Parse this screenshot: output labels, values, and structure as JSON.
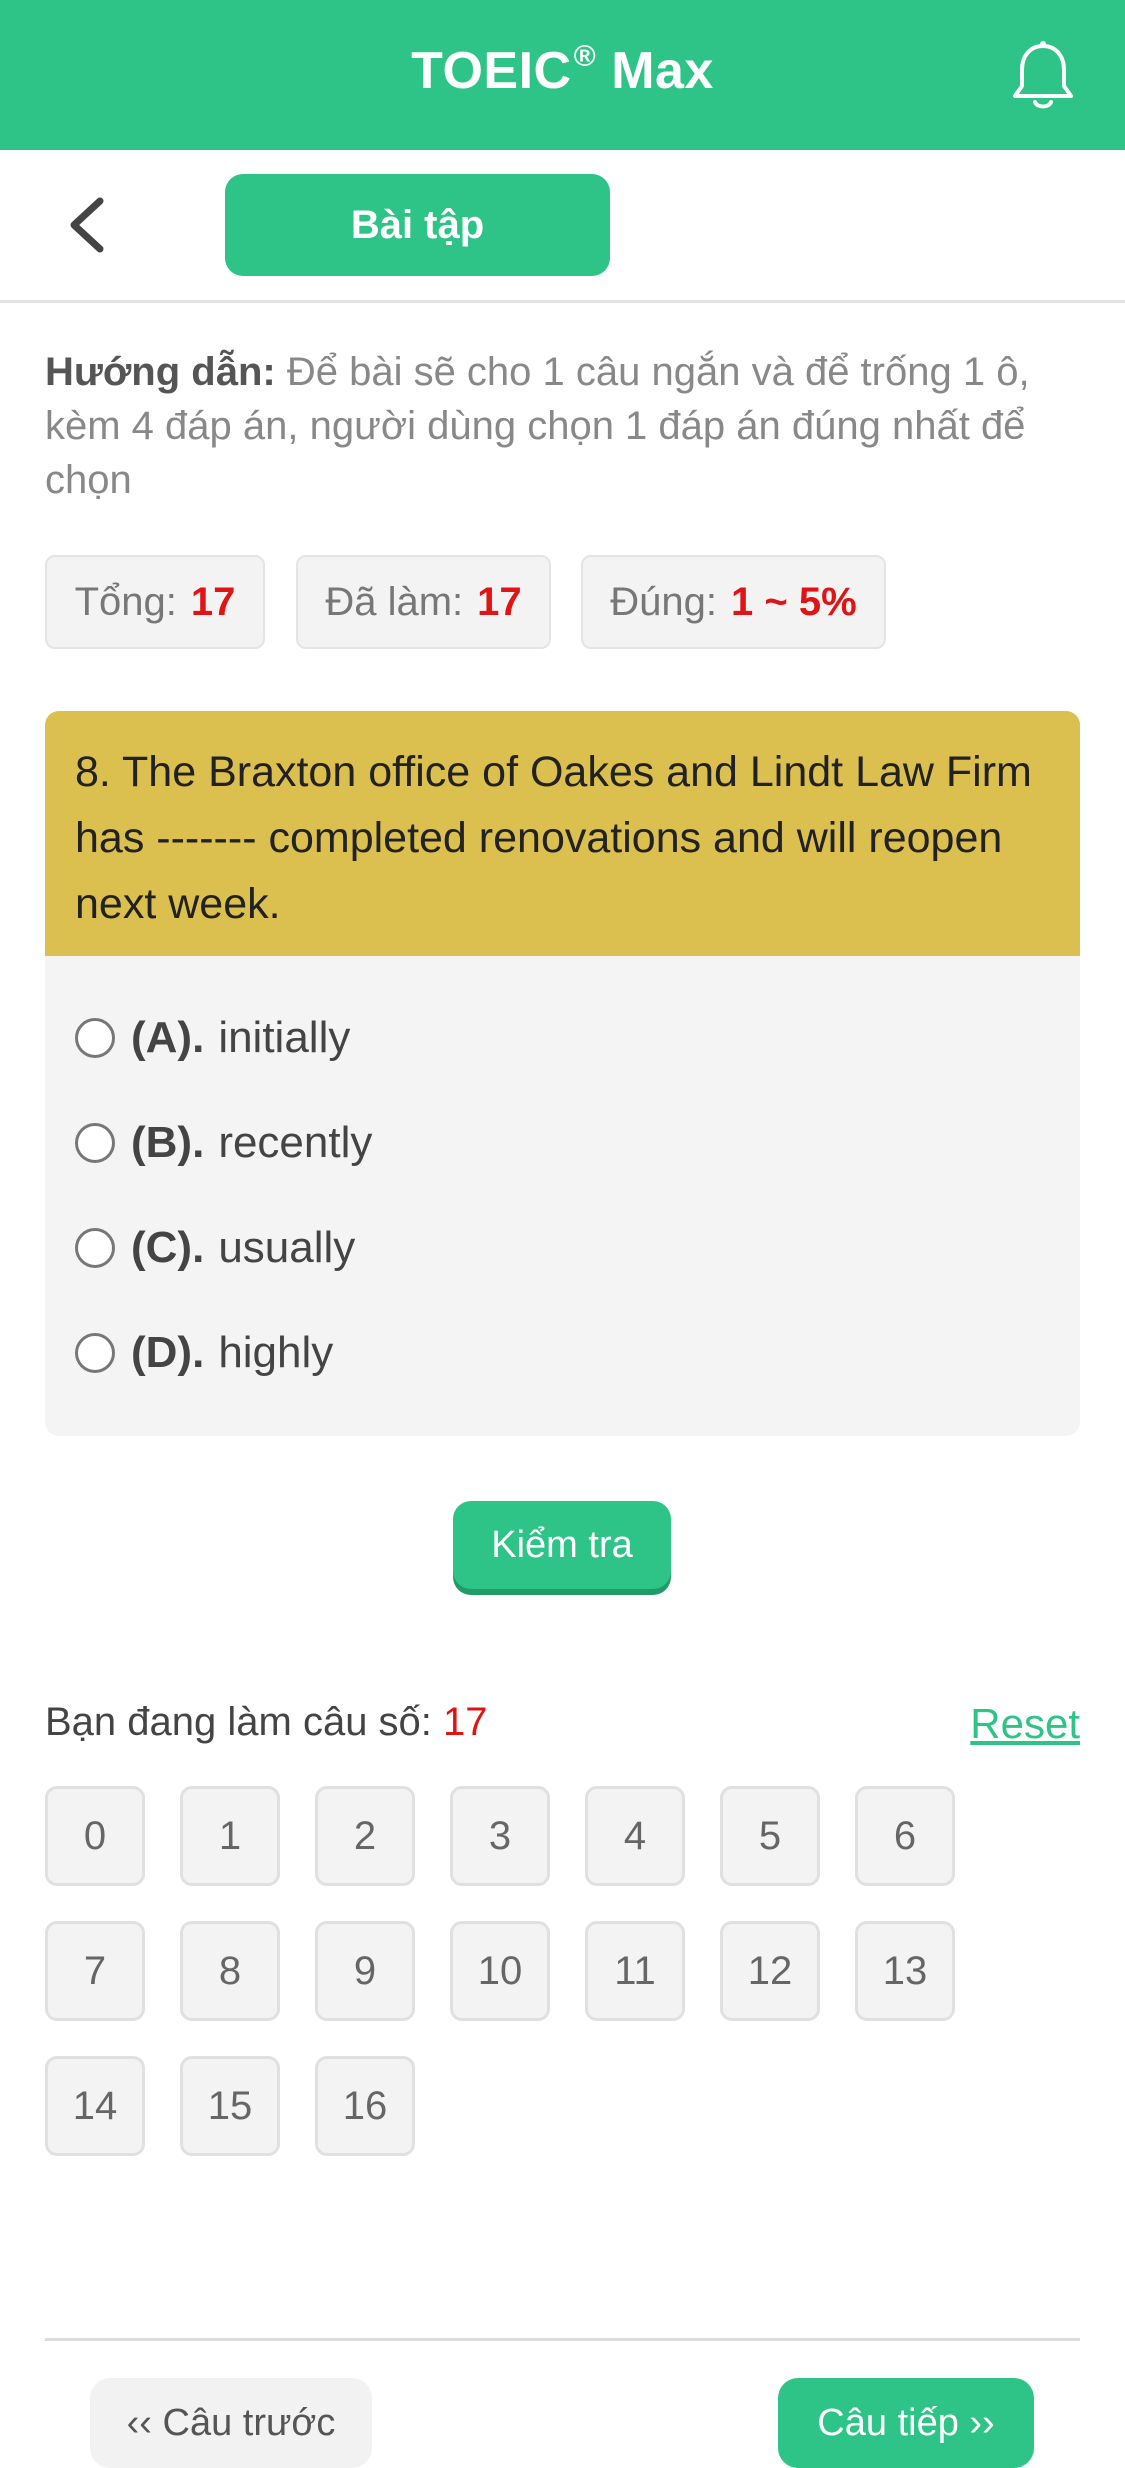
{
  "header": {
    "title": "TOEIC",
    "title_mark": "®",
    "title_suffix": "Max",
    "notification_icon": "bell-icon"
  },
  "subheader": {
    "back_icon": "chevron-left-icon",
    "tab_label": "Bài tập"
  },
  "instructions": {
    "label": "Hướng dẫn:",
    "text": "Để bài sẽ cho 1 câu ngắn và để trống 1 ô, kèm 4 đáp án, người dùng chọn 1 đáp án đúng nhất để chọn"
  },
  "stats": {
    "total_label": "Tổng:",
    "total_value": "17",
    "done_label": "Đã làm:",
    "done_value": "17",
    "correct_label": "Đúng:",
    "correct_value": "1 ~ 5%"
  },
  "question": {
    "text": "8. The Braxton office of Oakes and Lindt Law Firm has ------- completed renovations and will reopen next week.",
    "options": [
      {
        "letter": "(A).",
        "text": "initially"
      },
      {
        "letter": "(B).",
        "text": "recently"
      },
      {
        "letter": "(C).",
        "text": "usually"
      },
      {
        "letter": "(D).",
        "text": "highly"
      }
    ]
  },
  "check_button": "Kiểm tra",
  "progress": {
    "label": "Bạn đang làm câu số:",
    "current": "17",
    "reset_label": "Reset"
  },
  "question_numbers": [
    "0",
    "1",
    "2",
    "3",
    "4",
    "5",
    "6",
    "7",
    "8",
    "9",
    "10",
    "11",
    "12",
    "13",
    "14",
    "15",
    "16"
  ],
  "navigation": {
    "prev_label": "‹‹ Câu trước",
    "next_label": "Câu tiếp ››"
  },
  "colors": {
    "brand": "#2ec488",
    "question_header": "#dbbf4f",
    "highlight": "#e01414"
  }
}
